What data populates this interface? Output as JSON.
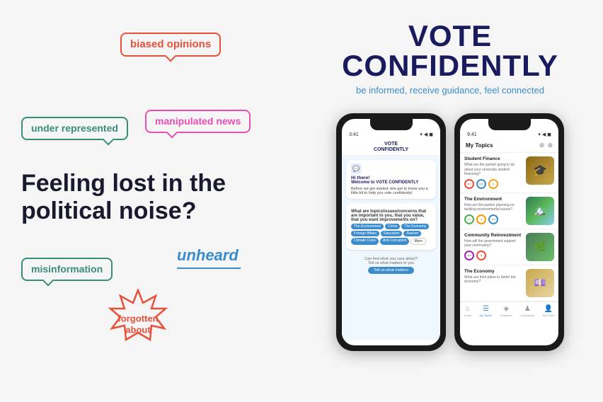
{
  "left": {
    "bubbles": {
      "biased": "biased opinions",
      "under": "under represented",
      "manipulated": "manipulated news",
      "misinformation": "misinformation",
      "unheard": "unheard",
      "forgotten": "forgotten about"
    },
    "heading_line1": "Feeling lost in the",
    "heading_line2": "political noise?"
  },
  "right": {
    "title_line1": "VOTE",
    "title_line2": "CONFIDENTLY",
    "subtitle": "be informed, receive guidance, feel connected",
    "phone1": {
      "status": "3:41",
      "logo_line1": "VOTE",
      "logo_line2": "CONFIDENTLY",
      "greeting": "Hi there!",
      "welcome": "Welcome to VOTE CONFIDENTLY",
      "intro": "Before we get started, lets get to know you a little bit to help you vote confidently!",
      "question": "What are topics/issues/concerns that are important to you, that you value, that you want improvements on?",
      "tags": [
        "The Environment",
        "Crime",
        "The Economy",
        "Foreign Affairs",
        "Education",
        "Racism",
        "Climate Crisis",
        "Anti-Corruption",
        "More"
      ],
      "footer": "Can find what you care about?",
      "footer2": "Tell us what matters to you",
      "btn": "Tell us what matters"
    },
    "phone2": {
      "status": "9:41",
      "header": "My Topics",
      "topics": [
        {
          "name": "Student Finance",
          "desc": "What are the parties going to do about your university student financing?",
          "emoji": "🎓"
        },
        {
          "name": "The Environment",
          "desc": "How are the parties planning on tackling environmental issues?",
          "emoji": "🏔️"
        },
        {
          "name": "Community Reinvestment",
          "desc": "How will the government support your community?",
          "emoji": "🌿"
        },
        {
          "name": "The Economy",
          "desc": "What are their plans to better the economy?",
          "emoji": "💷"
        }
      ],
      "nav": [
        "Home",
        "My Topics",
        "Guidance",
        "Community",
        "My Panel"
      ]
    }
  }
}
